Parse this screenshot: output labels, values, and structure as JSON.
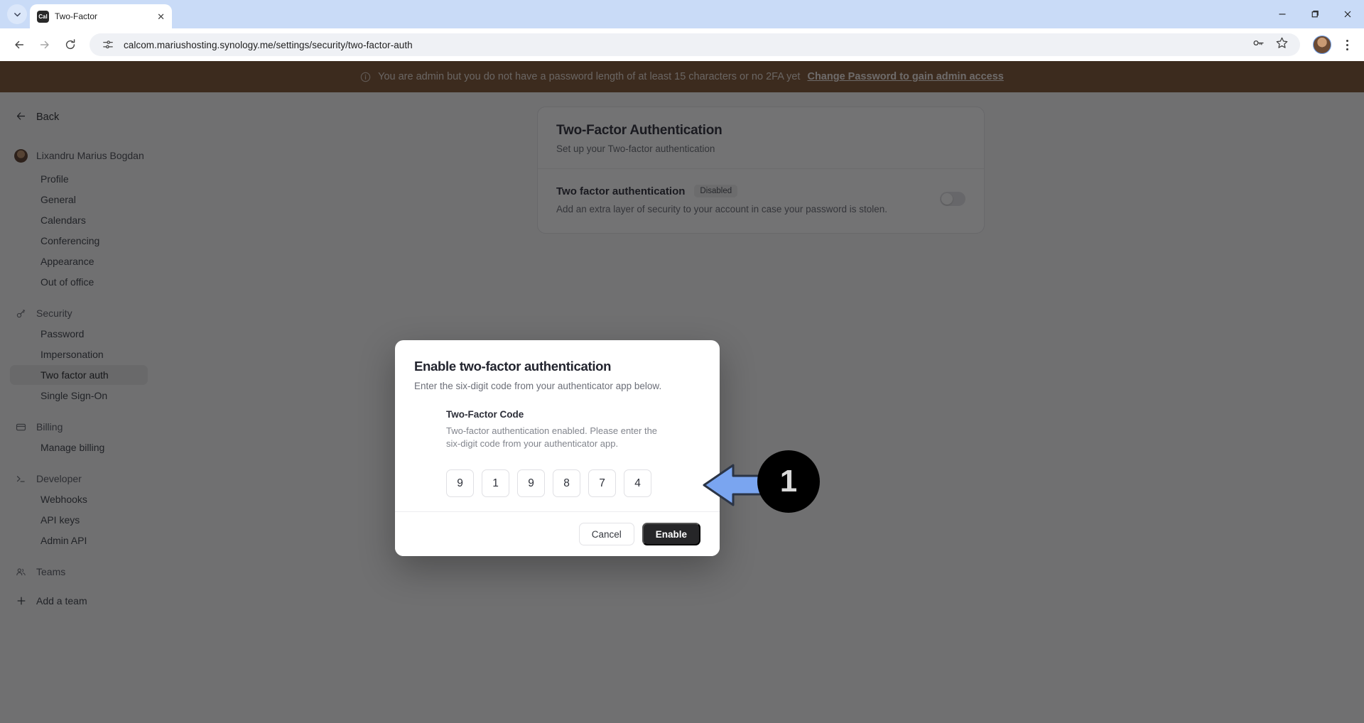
{
  "browser": {
    "tab": {
      "title": "Two-Factor",
      "favicon_text": "Cal",
      "close_icon": "close-icon"
    },
    "tab_search_icon": "chevron-down-icon",
    "window": {
      "minimize": "minimize-icon",
      "maximize": "maximize-icon",
      "close": "close-icon"
    },
    "nav": {
      "back": "back-arrow-icon",
      "forward": "forward-arrow-icon",
      "reload": "reload-icon"
    },
    "omnibox": {
      "site_icon": "page-settings-icon",
      "url": "calcom.mariushosting.synology.me/settings/security/two-factor-auth",
      "password_icon": "key-icon",
      "bookmark_icon": "star-icon"
    },
    "profile_icon": "avatar",
    "menu_icon": "kebab-menu-icon"
  },
  "banner": {
    "icon": "info-icon",
    "text": "You are admin but you do not have a password length of at least 15 characters or no 2FA yet",
    "link": "Change Password to gain admin access",
    "bg_color": "#7d5334"
  },
  "sidebar": {
    "back_label": "Back",
    "back_icon": "arrow-left-icon",
    "user": {
      "name": "Lixandru Marius Bogdan",
      "avatar": "user-avatar"
    },
    "account_items": [
      {
        "label": "Profile"
      },
      {
        "label": "General"
      },
      {
        "label": "Calendars"
      },
      {
        "label": "Conferencing"
      },
      {
        "label": "Appearance"
      },
      {
        "label": "Out of office"
      }
    ],
    "groups": [
      {
        "label": "Security",
        "icon": "key-icon",
        "items": [
          {
            "label": "Password",
            "active": false
          },
          {
            "label": "Impersonation",
            "active": false
          },
          {
            "label": "Two factor auth",
            "active": true
          },
          {
            "label": "Single Sign-On",
            "active": false
          }
        ]
      },
      {
        "label": "Billing",
        "icon": "credit-card-icon",
        "items": [
          {
            "label": "Manage billing",
            "active": false
          }
        ]
      },
      {
        "label": "Developer",
        "icon": "terminal-icon",
        "items": [
          {
            "label": "Webhooks",
            "active": false
          },
          {
            "label": "API keys",
            "active": false
          },
          {
            "label": "Admin API",
            "active": false
          }
        ]
      },
      {
        "label": "Teams",
        "icon": "users-icon",
        "items": []
      }
    ],
    "add_team": {
      "label": "Add a team",
      "icon": "plus-icon"
    }
  },
  "card": {
    "title": "Two-Factor Authentication",
    "subtitle": "Set up your Two-factor authentication",
    "row": {
      "title": "Two factor authentication",
      "badge": "Disabled",
      "description": "Add an extra layer of security to your account in case your password is stolen.",
      "toggle_state": "off"
    }
  },
  "modal": {
    "title": "Enable two-factor authentication",
    "subtitle": "Enter the six-digit code from your authenticator app below.",
    "field_label": "Two-Factor Code",
    "field_help": "Two-factor authentication enabled. Please enter the six-digit code from your authenticator app.",
    "code_digits": [
      "9",
      "1",
      "9",
      "8",
      "7",
      "4"
    ],
    "cancel_label": "Cancel",
    "enable_label": "Enable"
  },
  "annotation": {
    "step_number": "1",
    "arrow_color": "#7aa5f0",
    "badge_color": "#000000"
  }
}
